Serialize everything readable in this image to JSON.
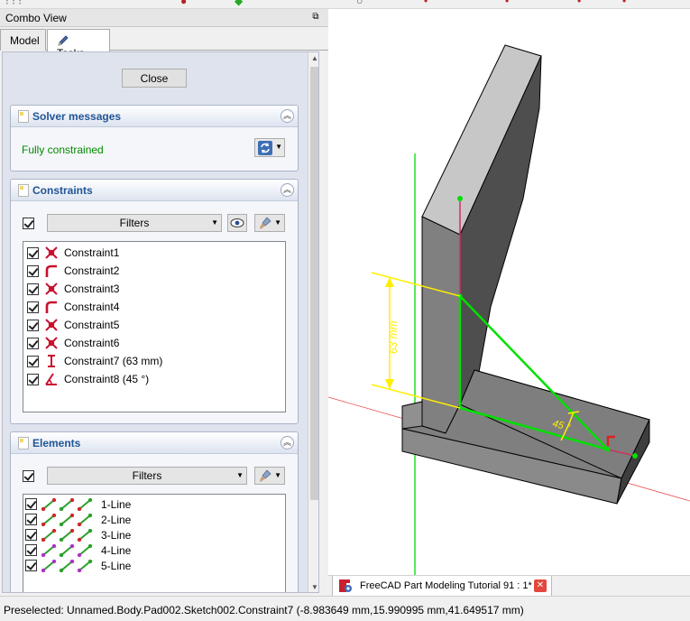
{
  "combo_view": {
    "title": "Combo View",
    "tabs": [
      {
        "label": "Model"
      },
      {
        "label": "Tasks"
      }
    ]
  },
  "tasks": {
    "close_label": "Close",
    "solver": {
      "title": "Solver messages",
      "status": "Fully constrained"
    },
    "constraints": {
      "title": "Constraints",
      "filters_label": "Filters",
      "items": [
        {
          "label": "Constraint1",
          "icon": "coincident-icon"
        },
        {
          "label": "Constraint2",
          "icon": "tangent-icon"
        },
        {
          "label": "Constraint3",
          "icon": "coincident-icon"
        },
        {
          "label": "Constraint4",
          "icon": "tangent-icon"
        },
        {
          "label": "Constraint5",
          "icon": "coincident-icon"
        },
        {
          "label": "Constraint6",
          "icon": "coincident-icon"
        },
        {
          "label": "Constraint7 (63 mm)",
          "icon": "distance-icon"
        },
        {
          "label": "Constraint8 (45 °)",
          "icon": "angle-icon"
        }
      ]
    },
    "elements": {
      "title": "Elements",
      "filters_label": "Filters",
      "items": [
        {
          "label": "1-Line"
        },
        {
          "label": "2-Line"
        },
        {
          "label": "3-Line"
        },
        {
          "label": "4-Line"
        },
        {
          "label": "5-Line"
        }
      ]
    }
  },
  "viewport": {
    "dim_length": "63 mm",
    "dim_angle": "45 °"
  },
  "document_tab": {
    "name": "FreeCAD Part Modeling Tutorial 91 : 1*"
  },
  "statusbar": {
    "text": "Preselected: Unnamed.Body.Pad002.Sketch002.Constraint7 (-8.983649 mm,15.990995 mm,41.649517 mm)"
  },
  "colors": {
    "solver_ok": "#008a00",
    "panel_title": "#215596",
    "constraint_red": "#c8102e",
    "sketch_green": "#00e000",
    "dimension_yellow": "#ffee00",
    "body_face": "#7f7f7f"
  }
}
